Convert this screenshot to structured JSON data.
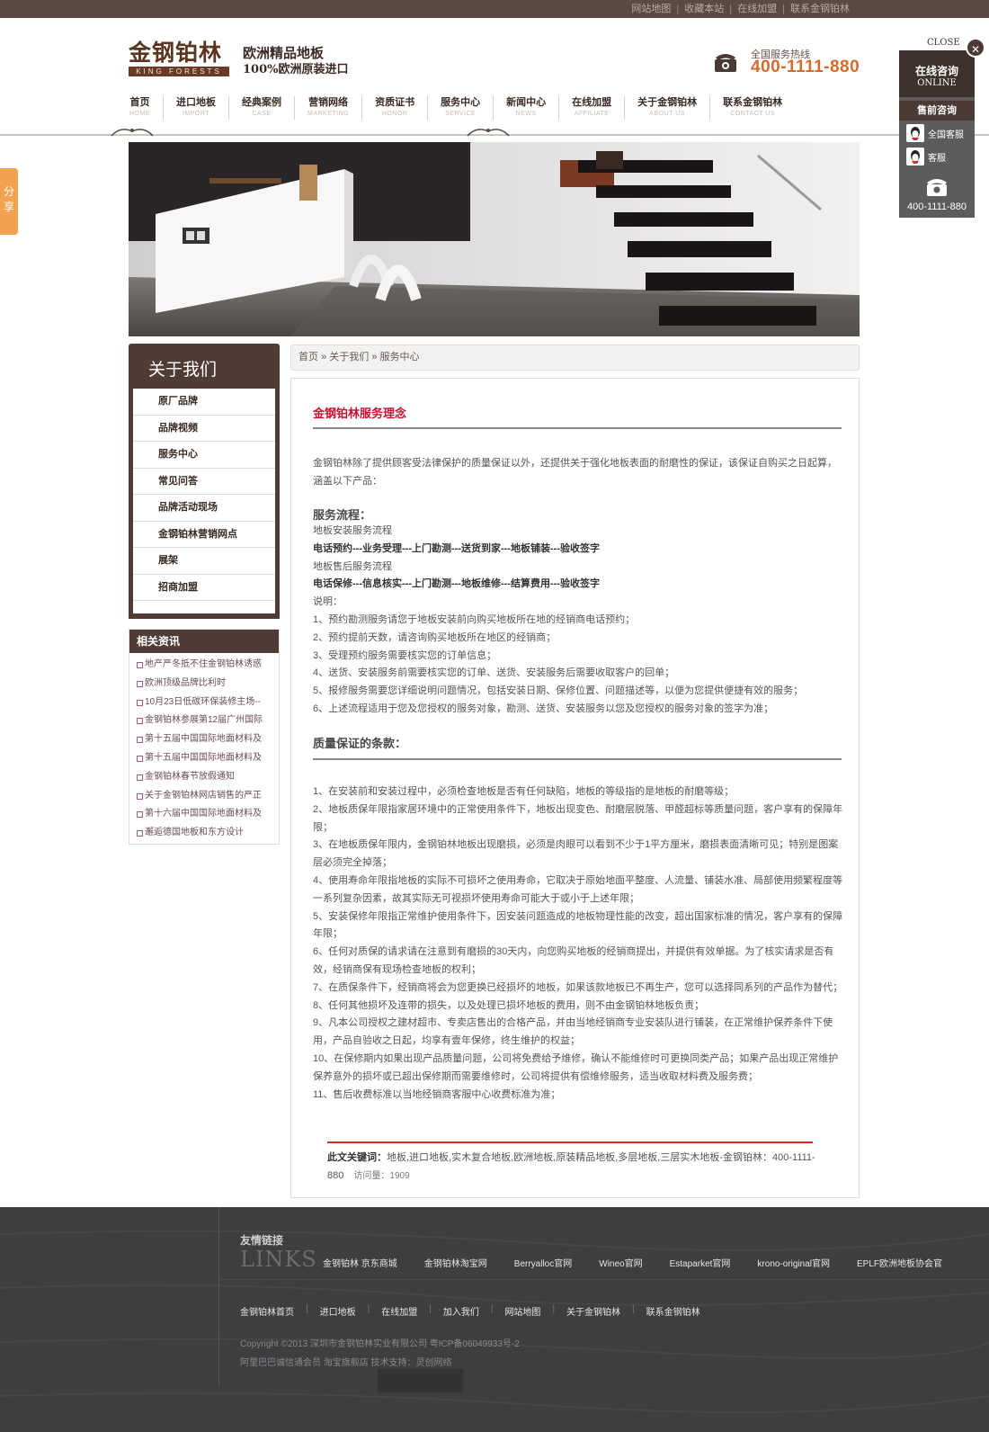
{
  "topbar": {
    "links": [
      "网站地图",
      "收藏本站",
      "在线加盟",
      "联系金钢铂林"
    ]
  },
  "brand": {
    "logo_cn": "金钢铂林",
    "logo_en": "KING FORESTS",
    "slogan_1": "欧洲精品地板",
    "slogan_2": "100%欧洲原装进口"
  },
  "hotline": {
    "label": "全国服务热线",
    "number": "400-1111-880"
  },
  "nav": [
    {
      "cn": "首页",
      "en": "HOME"
    },
    {
      "cn": "进口地板",
      "en": "IMPORT"
    },
    {
      "cn": "经典案例",
      "en": "CASE"
    },
    {
      "cn": "营销网络",
      "en": "MARKETING"
    },
    {
      "cn": "资质证书",
      "en": "HONOR"
    },
    {
      "cn": "服务中心",
      "en": "SERVICE"
    },
    {
      "cn": "新闻中心",
      "en": "NEWS"
    },
    {
      "cn": "在线加盟",
      "en": "AFFILIATE"
    },
    {
      "cn": "关于金钢铂林",
      "en": "ABOUT US"
    },
    {
      "cn": "联系金钢铂林",
      "en": "CONTACT US"
    }
  ],
  "sidebar": {
    "title": "关于我们",
    "items": [
      "原厂品牌",
      "品牌视频",
      "服务中心",
      "常见问答",
      "品牌活动现场",
      "金钢铂林营销网点",
      "展架",
      "招商加盟"
    ]
  },
  "related": {
    "title": "相关资讯",
    "items": [
      "地产严冬抵不住金钢铂林诱惑",
      "欧洲顶级品牌比利时",
      "10月23日低碳环保装修主场--",
      "金钢铂林参展第12届广州国际",
      "第十五届中国国际地面材料及",
      "第十五届中国国际地面材料及",
      "金钢铂林春节放假通知",
      "关于金钢铂林网店销售的严正",
      "第十六届中国国际地面材料及",
      "邂逅德国地板和东方设计"
    ]
  },
  "breadcrumb": {
    "home": "首页",
    "sep": "»",
    "parent": "关于我们",
    "current": "服务中心"
  },
  "article": {
    "title": "金钢铂林服务理念",
    "intro": "金钢铂林除了提供顾客受法律保护的质量保证以外，还提供关于强化地板表面的耐磨性的保证，该保证自购买之日起算，涵盖以下产品：",
    "process_heading": "服务流程：",
    "process_lines": [
      {
        "text": "地板安装服务流程",
        "bold": false
      },
      {
        "text": "电话预约---业务受理---上门勘测---送货到家---地板铺装---验收签字",
        "bold": true
      },
      {
        "text": "地板售后服务流程",
        "bold": false
      },
      {
        "text": "电话保修---信息核实---上门勘测---地板维修---结算费用---验收签字",
        "bold": true
      },
      {
        "text": "说明：",
        "bold": false
      },
      {
        "text": "1、预约勘测服务请您于地板安装前向购买地板所在地的经销商电话预约；",
        "bold": false
      },
      {
        "text": "2、预约提前天数，请咨询购买地板所在地区的经销商；",
        "bold": false
      },
      {
        "text": "3、受理预约服务需要核实您的订单信息；",
        "bold": false
      },
      {
        "text": "4、送货、安装服务前需要核实您的订单、送货、安装服务后需要收取客户的回单；",
        "bold": false
      },
      {
        "text": "5、报修服务需要您详细说明问题情况，包括安装日期、保修位置、问题描述等，以便为您提供便捷有效的服务；",
        "bold": false
      },
      {
        "text": "6、上述流程适用于您及您授权的服务对象，勘测、送货、安装服务以您及您授权的服务对象的签字为准；",
        "bold": false
      }
    ],
    "quality_heading": "质量保证的条款：",
    "quality_items": [
      "1、在安装前和安装过程中，必须检查地板是否有任何缺陷，地板的等级指的是地板的耐磨等级；",
      "2、地板质保年限指家居环境中的正常使用条件下，地板出现变色、耐磨层脱落、甲醛超标等质量问题，客户享有的保障年限；",
      "3、在地板质保年限内，金钢铂林地板出现磨损，必须是肉眼可以看到不少于1平方厘米，磨损表面清晰可见；特别是图案层必须完全掉落；",
      "4、使用寿命年限指地板的实际不可损坏之使用寿命，它取决于原始地面平整度、人流量、铺装水准、局部使用频繁程度等一系列复杂因素，故其实际无可视损坏使用寿命可能大于或小于上述年限；",
      "5、安装保修年限指正常维护使用条件下，因安装问题造成的地板物理性能的改变，超出国家标准的情况，客户享有的保障年限；",
      "6、任何对质保的请求请在注意到有磨损的30天内，向您购买地板的经销商提出，并提供有效单据。为了核实请求是否有效，经销商保有现场检查地板的权利；",
      "7、在质保条件下，经销商将会为您更换已经损坏的地板，如果该款地板已不再生产，您可以选择同系列的产品作为替代；",
      "8、任何其他损坏及连带的损失，以及处理已损坏地板的费用，则不由金钢铂林地板负责；",
      "9、凡本公司授权之建材超市、专卖店售出的合格产品，并由当地经销商专业安装队进行铺装，在正常维护保养条件下使用，产品自验收之日起，均享有壹年保修，终生维护的权益；",
      "10、在保修期内如果出现产品质量问题，公司将免费给予维修，确认不能维修时可更换同类产品；如果产品出现正常维护保养意外的损坏或已超出保修期而需要维修时，公司将提供有偿维修服务，适当收取材料费及服务费；",
      "11、售后收费标准以当地经销商客服中心收费标准为准；"
    ],
    "keywords_label": "此文关键词：",
    "keywords": "地板,进口地板,实木复合地板,欧洲地板,原装精品地板,多层地板,三层实木地板-金钢铂林：400-1111-880",
    "visits_label": "访问量：",
    "visits": "1909"
  },
  "footer": {
    "links_title": "友情链接",
    "links_title_en": "LINKS",
    "friend_links": [
      "金钢铂林 京东商城",
      "金钢铂林淘宝网",
      "Berryalloc官网",
      "Wineo官网",
      "Estaparket官网",
      "krono-original官网",
      "EPLF欧洲地板协会官"
    ],
    "nav": [
      "金钢铂林首页",
      "进口地板",
      "在线加盟",
      "加入我们",
      "网站地图",
      "关于金钢铂林",
      "联系金钢铂林"
    ],
    "copyright": "Copyright ©2013 深圳市金钢铂林实业有限公司 粤ICP备06049933号-2",
    "support": "阿里巴巴诚信通会员 淘宝旗舰店 技术支持：灵创网络"
  },
  "share": {
    "label": "分享"
  },
  "float": {
    "close": "CLOSE",
    "head_cn": "在线咨询",
    "head_en": "ONLINE",
    "presale": "售前咨询",
    "qq": [
      "全国客服",
      "客服"
    ],
    "phone": "400-1111-880"
  },
  "colors": {
    "brand_brown": "#4f3c35",
    "accent_red": "#c4122f",
    "hotline_orange": "#d86a2b",
    "share_orange": "#f2a24e"
  }
}
